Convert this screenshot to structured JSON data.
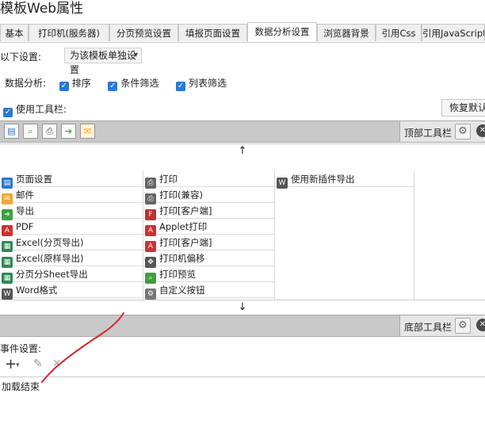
{
  "window": {
    "title": "模板Web属性"
  },
  "tabs": [
    {
      "label": "基本"
    },
    {
      "label": "打印机(服务器)"
    },
    {
      "label": "分页预览设置"
    },
    {
      "label": "填报页面设置"
    },
    {
      "label": "数据分析设置"
    },
    {
      "label": "浏览器背景"
    },
    {
      "label": "引用Css"
    },
    {
      "label": "引用JavaScript"
    }
  ],
  "active_tab": "数据分析设置",
  "settings": {
    "label": "以下设置:",
    "select_value": "为该模板单独设置"
  },
  "analysis": {
    "label": "数据分析:",
    "options": [
      {
        "label": "排序",
        "checked": true
      },
      {
        "label": "条件筛选",
        "checked": true
      },
      {
        "label": "列表筛选",
        "checked": true
      }
    ]
  },
  "toolbar_option": {
    "label": "使用工具栏:",
    "checked": true,
    "restore_label": "恢复默认"
  },
  "top_toolbar": {
    "label": "顶部工具栏",
    "icons": [
      "page-setup-icon",
      "print-preview-icon",
      "print-icon",
      "export-icon",
      "email-icon"
    ]
  },
  "bottom_toolbar": {
    "label": "底部工具栏"
  },
  "arrows": {
    "up": "↑",
    "down": "↓"
  },
  "buttons": {
    "col1": [
      {
        "label": "页面设置",
        "icon": "page-setup-icon",
        "color": "#2b79d0",
        "glyph": "▤"
      },
      {
        "label": "邮件",
        "icon": "email-icon",
        "color": "#f0a830",
        "glyph": "✉"
      },
      {
        "label": "导出",
        "icon": "export-icon",
        "color": "#3ca03c",
        "glyph": "➔"
      },
      {
        "label": "PDF",
        "icon": "pdf-icon",
        "color": "#d03030",
        "glyph": "A"
      },
      {
        "label": "Excel(分页导出)",
        "icon": "excel-icon",
        "color": "#2e8b57",
        "glyph": "▦"
      },
      {
        "label": "Excel(原样导出)",
        "icon": "excel-icon",
        "color": "#2e8b57",
        "glyph": "▦"
      },
      {
        "label": "分页分Sheet导出",
        "icon": "excel-icon",
        "color": "#2e8b57",
        "glyph": "▦"
      },
      {
        "label": "Word格式",
        "icon": "word-icon",
        "color": "#555555",
        "glyph": "W"
      }
    ],
    "col2": [
      {
        "label": "打印",
        "icon": "print-icon",
        "color": "#666666",
        "glyph": "⎙"
      },
      {
        "label": "打印(兼容)",
        "icon": "print-icon",
        "color": "#666666",
        "glyph": "⎙"
      },
      {
        "label": "打印[客户端]",
        "icon": "flash-print-icon",
        "color": "#c03030",
        "glyph": "F"
      },
      {
        "label": "Applet打印",
        "icon": "pdf-icon",
        "color": "#d03030",
        "glyph": "A"
      },
      {
        "label": "打印[客户端]",
        "icon": "pdf-icon",
        "color": "#d03030",
        "glyph": "A"
      },
      {
        "label": "打印机偏移",
        "icon": "move-icon",
        "color": "#555555",
        "glyph": "✥"
      },
      {
        "label": "打印预览",
        "icon": "print-preview-icon",
        "color": "#3ca03c",
        "glyph": "⌕"
      },
      {
        "label": "自定义按钮",
        "icon": "gear-icon",
        "color": "#777777",
        "glyph": "⚙"
      }
    ],
    "col3": [
      {
        "label": "使用新插件导出",
        "icon": "word-icon",
        "color": "#555555",
        "glyph": "W"
      }
    ]
  },
  "events": {
    "label": "事件设置:",
    "tools": [
      "add-icon",
      "edit-icon",
      "delete-icon"
    ],
    "items": [
      {
        "label": "加载结束"
      }
    ]
  }
}
